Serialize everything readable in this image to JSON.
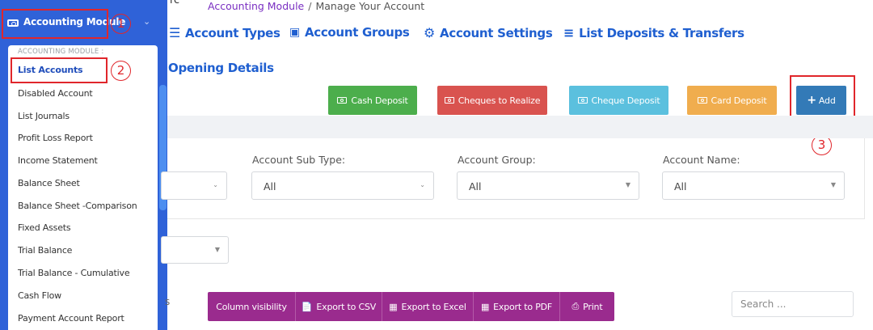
{
  "sidebar": {
    "module_label": "Accounting Module",
    "dropdown_title": "ACCOUNTING MODULE :",
    "items": [
      {
        "label": "List Accounts"
      },
      {
        "label": "Disabled Account"
      },
      {
        "label": "List Journals"
      },
      {
        "label": "Profit Loss Report"
      },
      {
        "label": "Income Statement"
      },
      {
        "label": "Balance Sheet"
      },
      {
        "label": "Balance Sheet -Comparison"
      },
      {
        "label": "Fixed Assets"
      },
      {
        "label": "Trial Balance"
      },
      {
        "label": "Trial Balance - Cumulative"
      },
      {
        "label": "Cash Flow"
      },
      {
        "label": "Payment Account Report"
      }
    ]
  },
  "annotations": {
    "one": "1",
    "two": "2",
    "three": "3"
  },
  "top_fragment": "rc",
  "breadcrumb": {
    "link": "Accounting Module",
    "separator": "/",
    "current": "Manage Your Account"
  },
  "nav_tabs": [
    {
      "label": "Account Types",
      "icon": "list-icon"
    },
    {
      "label": "Account Groups",
      "icon": "group-icon"
    },
    {
      "label": "Account Settings",
      "icon": "gears-icon"
    },
    {
      "label": "List Deposits & Transfers",
      "icon": "list-ul-icon"
    }
  ],
  "section_title": "Opening Details",
  "action_buttons": {
    "cash_deposit": "Cash Deposit",
    "cheques_to_realize": "Cheques to Realize",
    "cheque_deposit": "Cheque Deposit",
    "card_deposit": "Card Deposit",
    "add": "Add"
  },
  "filters": {
    "account_sub_type": {
      "label": "Account Sub Type:",
      "value": "All"
    },
    "account_group": {
      "label": "Account Group:",
      "value": "All"
    },
    "account_name": {
      "label": "Account Name:",
      "value": "All"
    }
  },
  "table_tools": {
    "left_fragment": "s",
    "column_visibility": "Column visibility",
    "export_csv": "Export to CSV",
    "export_excel": "Export to Excel",
    "export_pdf": "Export to PDF",
    "print": "Print",
    "search_placeholder": "Search ..."
  },
  "colors": {
    "sidebar": "#2f62d8",
    "accent_blue": "#1f5fd0",
    "breadcrumb_link": "#7a2fc2",
    "cash": "#4cae4c",
    "cheques": "#d9534f",
    "cheque_deposit": "#5bc0de",
    "card": "#f0ad4e",
    "add": "#337ab7",
    "toolbar": "#9a2b8e",
    "annotation": "#e0262b"
  }
}
